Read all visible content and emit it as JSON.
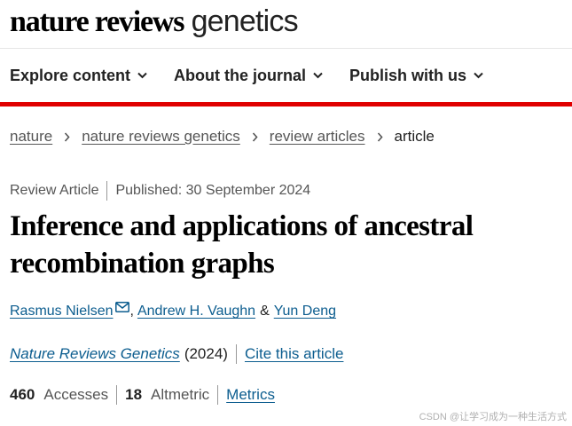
{
  "logo": {
    "bold": "nature reviews",
    "light": "genetics"
  },
  "nav": {
    "items": [
      {
        "label": "Explore content",
        "icon": "chevron-down-icon"
      },
      {
        "label": "About the journal",
        "icon": "chevron-down-icon"
      },
      {
        "label": "Publish with us",
        "icon": "chevron-down-icon"
      }
    ]
  },
  "colors": {
    "accent_bar": "#e00000",
    "link": "#0c5d8f"
  },
  "breadcrumb": {
    "items": [
      "nature",
      "nature reviews genetics",
      "review articles"
    ],
    "current": "article",
    "separator_icon": "chevron-right-icon"
  },
  "article": {
    "type": "Review Article",
    "published": "Published: 30 September 2024",
    "title": "Inference and applications of ancestral recombination graphs",
    "authors": {
      "first": "Rasmus Nielsen",
      "comma": ",",
      "second": "Andrew H. Vaughn",
      "ampersand": "&",
      "third": "Yun Deng",
      "mail_icon": "envelope-icon"
    },
    "journal": "Nature Reviews Genetics",
    "year": "(2024)",
    "cite_label": "Cite this article"
  },
  "metrics": {
    "accesses_value": "460",
    "accesses_label": "Accesses",
    "altmetric_value": "18",
    "altmetric_label": "Altmetric",
    "metrics_link": "Metrics"
  },
  "watermark": "CSDN @让学习成为一种生活方式"
}
